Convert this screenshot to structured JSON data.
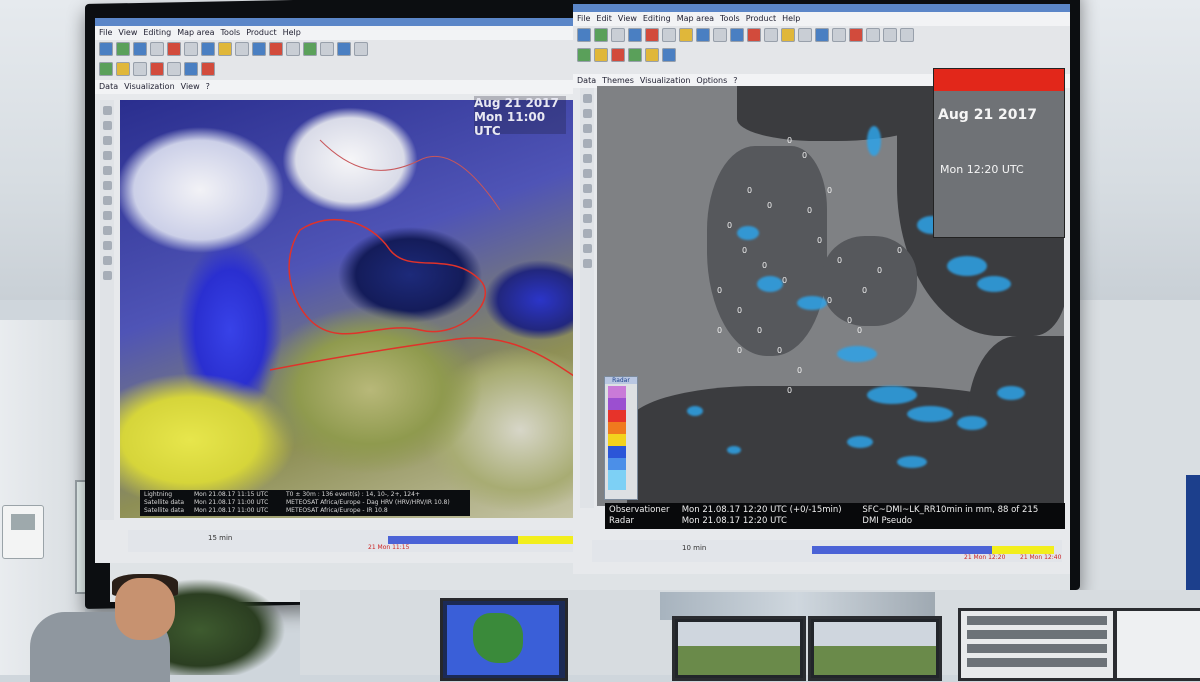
{
  "left_window": {
    "menu": [
      "File",
      "View",
      "Editing",
      "Map area",
      "Tools",
      "Product",
      "Help"
    ],
    "submenu": [
      "Data",
      "Visualization",
      "View",
      "?"
    ],
    "date_line1": "Aug 21 2017",
    "date_line2": "Mon 11:00 UTC",
    "legend": [
      {
        "label": "Lightning",
        "value": "Mon 21.08.17 11:15 UTC",
        "detail": "T0 ± 30m : 136 event(s) : 14, 10-, 2+, 124+"
      },
      {
        "label": "Satellite data",
        "value": "Mon 21.08.17 11:00 UTC",
        "detail": "METEOSAT Africa/Europe - Dag HRV (HRV/HRV/IR 10.8)"
      },
      {
        "label": "Satellite data",
        "value": "Mon 21.08.17 11:00 UTC",
        "detail": "METEOSAT Africa/Europe - IR 10.8"
      }
    ],
    "timeline_step": "15 min",
    "timeline_label": "21 Mon 11:15"
  },
  "right_window": {
    "menu": [
      "File",
      "Edit",
      "View",
      "Editing",
      "Map area",
      "Tools",
      "Product",
      "Help"
    ],
    "submenu": [
      "Data",
      "Themes",
      "Visualization",
      "Options",
      "?"
    ],
    "inset_date": "Aug 21 2017",
    "inset_time": "Mon 12:20 UTC",
    "scale_title": "Radar",
    "legend_row1_label": "Observationer",
    "legend_row1_value": "Mon 21.08.17 12:20 UTC (+0/-15min)",
    "legend_row1_detail": "SFC~DMI~LK_RR10min in mm, 88 of 215",
    "legend_row2_label": "Radar",
    "legend_row2_value": "Mon 21.08.17 12:20 UTC",
    "legend_row2_detail": "DMI Pseudo",
    "timeline_step": "10 min",
    "timeline_label_1": "21 Mon 12:20",
    "timeline_label_2": "21 Mon 12:40",
    "zero_marker": "0"
  },
  "colors": {
    "radar_blue": "#2ea3e8",
    "satellite_blue": "#2a2fd0",
    "satellite_yellow": "#e7e64c",
    "inset_red": "#e2271a",
    "timeline_blue": "#4a62d6",
    "timeline_yellow": "#f2ee1c"
  }
}
